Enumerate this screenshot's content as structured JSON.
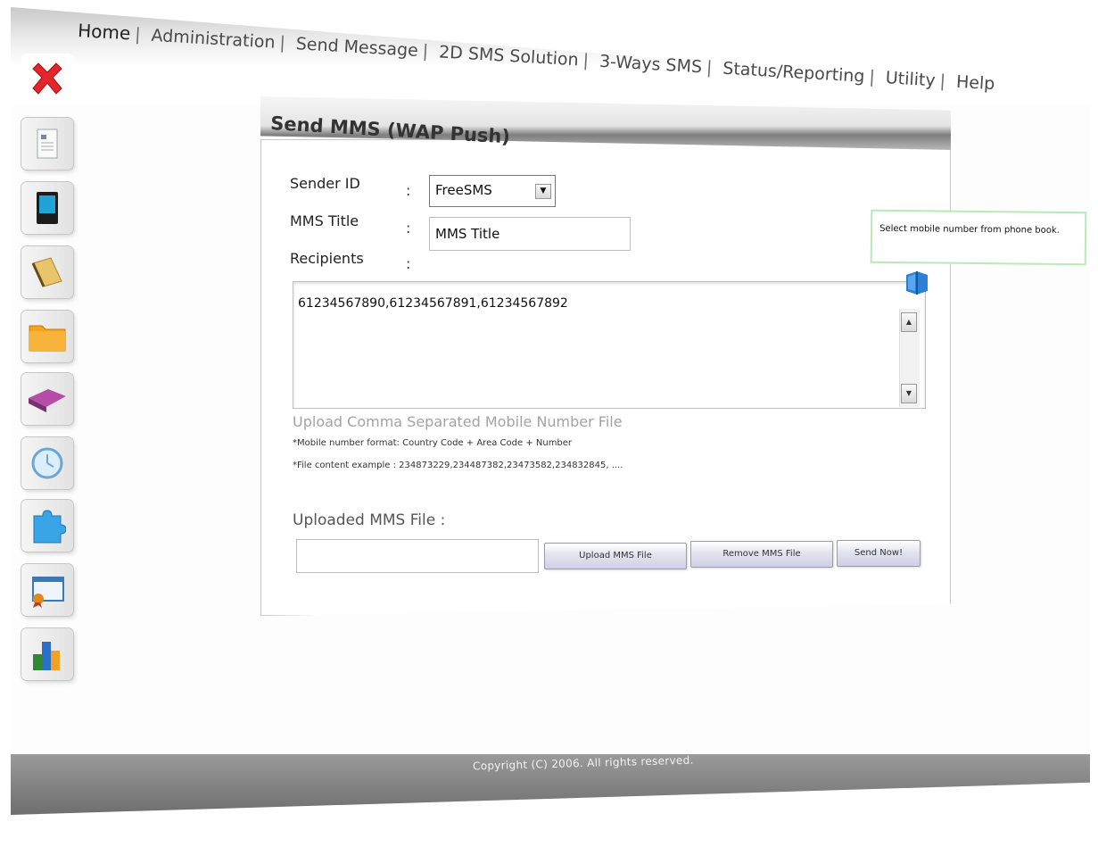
{
  "nav": {
    "items": [
      {
        "label": "Home"
      },
      {
        "label": "Administration"
      },
      {
        "label": "Send Message"
      },
      {
        "label": "2D SMS Solution"
      },
      {
        "label": "3-Ways SMS"
      },
      {
        "label": "Status/Reporting"
      },
      {
        "label": "Utility"
      },
      {
        "label": "Help"
      }
    ],
    "separator": "|"
  },
  "sidebar": {
    "items": [
      {
        "icon": "close-icon"
      },
      {
        "icon": "document-icon"
      },
      {
        "icon": "mobile-phone-icon"
      },
      {
        "icon": "notepad-icon"
      },
      {
        "icon": "folder-icon"
      },
      {
        "icon": "book-icon"
      },
      {
        "icon": "clock-icon"
      },
      {
        "icon": "puzzle-icon"
      },
      {
        "icon": "certificate-icon"
      },
      {
        "icon": "bar-chart-icon"
      }
    ]
  },
  "panel": {
    "title": "Send MMS (WAP Push)",
    "sender_label": "Sender ID",
    "sender_value": "FreeSMS",
    "title_label": "MMS Title",
    "title_value": "MMS Title",
    "recipients_label": "Recipients",
    "colon": ":",
    "recipients_value": "61234567890,61234567891,61234567892",
    "upload_hint": "Upload Comma Separated Mobile Number File",
    "format_note": "*Mobile number format: Country Code + Area Code + Number",
    "example_note": "*File content example : 234873229,234487382,23473582,234832845, ....",
    "uploaded_label": "Uploaded MMS File :",
    "uploaded_value": "",
    "upload_button": "Upload MMS File",
    "remove_button": "Remove MMS File",
    "send_button": "Send Now!"
  },
  "tooltip": {
    "text": "Select mobile number from phone book."
  },
  "footer": {
    "copyright": "Copyright (C) 2006. All rights reserved."
  },
  "colors": {
    "tooltip_border": "#b8eab8",
    "button_gradient_end": "#cfcfe6",
    "footer_bg": "#7a7a7a",
    "close_red": "#e3262b"
  }
}
